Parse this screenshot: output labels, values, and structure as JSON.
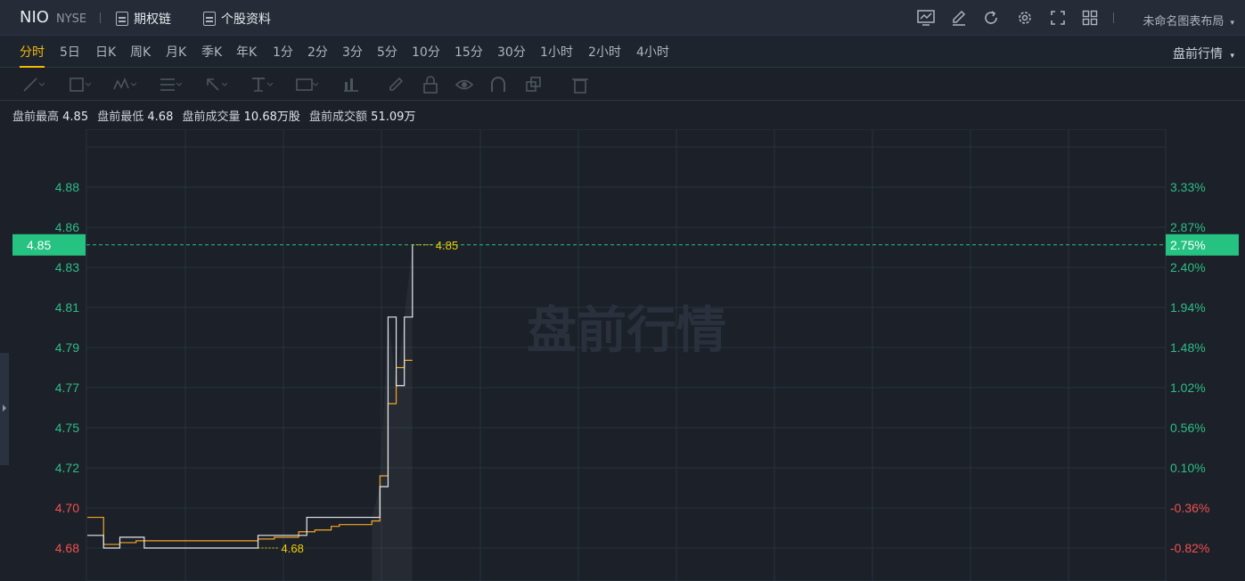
{
  "header": {
    "symbol": "NIO",
    "exchange": "NYSE",
    "options_chain": "期权链",
    "stock_profile": "个股资料",
    "layout_name": "未命名图表布局"
  },
  "intervals": [
    "分时",
    "5日",
    "日K",
    "周K",
    "月K",
    "季K",
    "年K",
    "1分",
    "2分",
    "3分",
    "5分",
    "10分",
    "15分",
    "30分",
    "1小时",
    "2小时",
    "4小时"
  ],
  "active_interval": "分时",
  "session_selector": "盘前行情",
  "stats": {
    "high_label": "盘前最高",
    "high": "4.85",
    "low_label": "盘前最低",
    "low": "4.68",
    "vol_label": "盘前成交量",
    "vol": "10.68万股",
    "amt_label": "盘前成交额",
    "amt": "51.09万"
  },
  "watermark": "盘前行情",
  "colors": {
    "up": "#2ebd85",
    "down": "#f0524f",
    "price_line": "#e6e9ee",
    "avg_line": "#f5a623",
    "marker": "#f0d000",
    "badge": "#26c281"
  },
  "chart_data": {
    "type": "line",
    "y_ticks_left": [
      "4.88",
      "4.86",
      "4.83",
      "4.81",
      "4.79",
      "4.77",
      "4.75",
      "4.72",
      "4.70",
      "4.68"
    ],
    "y_ticks_right": [
      "3.33%",
      "2.87%",
      "2.40%",
      "1.94%",
      "1.48%",
      "1.02%",
      "0.56%",
      "0.10%",
      "-0.36%",
      "-0.82%"
    ],
    "ylim": [
      4.68,
      4.88
    ],
    "current_price": "4.85",
    "current_change": "2.75%",
    "high_marker": "4.85",
    "low_marker": "4.68",
    "series": [
      {
        "x": [
          0,
          1,
          2,
          3,
          4,
          5,
          6,
          7,
          8,
          9,
          10,
          11,
          12,
          13,
          14,
          15,
          16,
          17,
          18,
          19,
          20,
          21,
          22,
          23,
          24,
          25,
          26,
          27,
          28,
          29,
          30,
          31,
          32,
          33,
          34,
          35,
          36,
          37,
          38,
          39,
          40
        ],
        "values": [
          4.687,
          4.687,
          4.68,
          4.68,
          4.686,
          4.686,
          4.686,
          4.68,
          4.68,
          4.68,
          4.68,
          4.68,
          4.68,
          4.68,
          4.68,
          4.68,
          4.68,
          4.68,
          4.68,
          4.68,
          4.68,
          4.687,
          4.687,
          4.687,
          4.687,
          4.687,
          4.687,
          4.697,
          4.697,
          4.697,
          4.697,
          4.697,
          4.697,
          4.697,
          4.697,
          4.697,
          4.714,
          4.808,
          4.77,
          4.808,
          4.848
        ]
      },
      {
        "x": [
          0,
          1,
          2,
          3,
          4,
          5,
          6,
          7,
          8,
          9,
          10,
          11,
          12,
          13,
          14,
          15,
          16,
          17,
          18,
          19,
          20,
          21,
          22,
          23,
          24,
          25,
          26,
          27,
          28,
          29,
          30,
          31,
          32,
          33,
          34,
          35,
          36,
          37,
          38,
          39,
          40
        ],
        "values": [
          4.697,
          4.697,
          4.682,
          4.682,
          4.683,
          4.683,
          4.684,
          4.684,
          4.684,
          4.684,
          4.684,
          4.684,
          4.684,
          4.684,
          4.684,
          4.684,
          4.684,
          4.684,
          4.684,
          4.684,
          4.684,
          4.685,
          4.685,
          4.686,
          4.686,
          4.686,
          4.689,
          4.689,
          4.69,
          4.69,
          4.692,
          4.693,
          4.693,
          4.693,
          4.693,
          4.695,
          4.72,
          4.76,
          4.78,
          4.784,
          4.784
        ]
      }
    ]
  }
}
